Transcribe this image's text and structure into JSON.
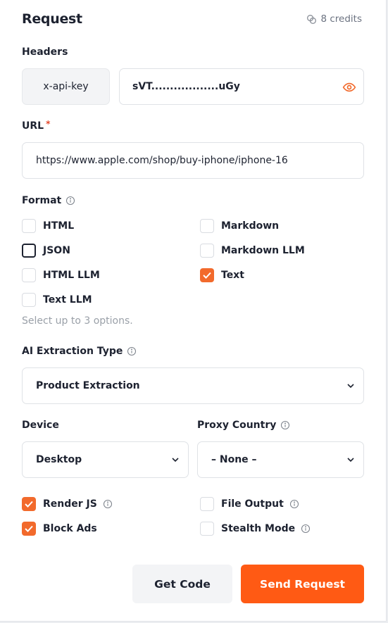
{
  "header": {
    "title": "Request",
    "credits": "8 credits"
  },
  "headers": {
    "label": "Headers",
    "key": "x-api-key",
    "value": "sVT..................uGy"
  },
  "url": {
    "label": "URL",
    "required_mark": "*",
    "value": "https://www.apple.com/shop/buy-iphone/iphone-16"
  },
  "format": {
    "label": "Format",
    "options": [
      {
        "label": "HTML",
        "checked": false
      },
      {
        "label": "Markdown",
        "checked": false
      },
      {
        "label": "JSON",
        "checked": false
      },
      {
        "label": "Markdown LLM",
        "checked": false
      },
      {
        "label": "HTML LLM",
        "checked": false
      },
      {
        "label": "Text",
        "checked": true
      },
      {
        "label": "Text LLM",
        "checked": false
      }
    ],
    "hint": "Select up to 3 options."
  },
  "ai_extraction": {
    "label": "AI Extraction Type",
    "value": "Product Extraction"
  },
  "device": {
    "label": "Device",
    "value": "Desktop"
  },
  "proxy_country": {
    "label": "Proxy Country",
    "value": "– None –"
  },
  "toggles": {
    "render_js": {
      "label": "Render JS",
      "checked": true
    },
    "block_ads": {
      "label": "Block Ads",
      "checked": true
    },
    "file_output": {
      "label": "File Output",
      "checked": false
    },
    "stealth_mode": {
      "label": "Stealth Mode",
      "checked": false
    }
  },
  "actions": {
    "get_code": "Get Code",
    "send_request": "Send Request"
  },
  "colors": {
    "accent": "#f26a2c",
    "primary_button": "#ff5a14"
  }
}
